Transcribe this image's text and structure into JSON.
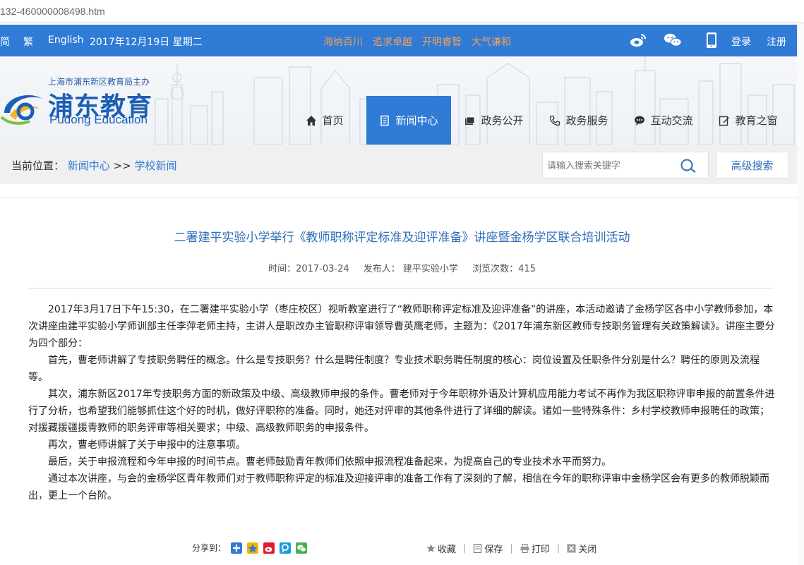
{
  "browser": {
    "url": "132-460000008498.htm"
  },
  "topbar": {
    "lang_simplified": "简",
    "lang_traditional": "繁",
    "lang_english": "English",
    "date": "2017年12月19日 星期二",
    "slogans": [
      "海纳百川",
      "追求卓越",
      "开明睿智",
      "大气谦和"
    ],
    "login": "登录",
    "register": "注册",
    "icons": [
      "weibo-icon",
      "wechat-icon",
      "mobile-icon"
    ]
  },
  "logo": {
    "subtitle": "上海市浦东新区教育局主办",
    "name_cn": "浦东教育",
    "name_en": "Pudong  Education"
  },
  "nav": {
    "items": [
      {
        "label": "首页",
        "icon": "home-icon"
      },
      {
        "label": "新闻中心",
        "icon": "document-icon",
        "active": true
      },
      {
        "label": "政务公开",
        "icon": "folder-icon"
      },
      {
        "label": "政务服务",
        "icon": "phone-icon"
      },
      {
        "label": "互动交流",
        "icon": "chat-icon"
      },
      {
        "label": "教育之窗",
        "icon": "edit-icon"
      }
    ]
  },
  "breadcrumb": {
    "prefix": "当前位置：",
    "level1": "新闻中心",
    "sep": " >> ",
    "level2": "学校新闻"
  },
  "search": {
    "placeholder": "请输入搜索关键字",
    "advanced": "高级搜索"
  },
  "article": {
    "title": "二署建平实验小学举行《教师职称评定标准及迎评准备》讲座暨金杨学区联合培训活动",
    "time": "时间：2017-03-24",
    "publisher": "发布人： 建平实验小学",
    "views": "浏览次数：415",
    "paragraphs": [
      "2017年3月17日下午15:30，在二署建平实验小学（枣庄校区）视听教室进行了“教师职称评定标准及迎评准备”的讲座，本活动邀请了金杨学区各中小学教师参加，本次讲座由建平实验小学师训部主任李萍老师主持，主讲人是职改办主管职称评审领导曹英鹰老师，主题为：《2017年浦东新区教师专技职务管理有关政策解读》。讲座主要分为四个部分：",
      "首先，曹老师讲解了专技职务聘任的概念。什么是专技职务？什么是聘任制度？专业技术职务聘任制度的核心：岗位设置及任职条件分别是什么？聘任的原则及流程等。",
      "其次，浦东新区2017年专技职务方面的新政策及中级、高级教师申报的条件。曹老师对于今年职称外语及计算机应用能力考试不再作为我区职称评审申报的前置条件进行了分析，也希望我们能够抓住这个好的时机，做好评职称的准备。同时，她还对评审的其他条件进行了详细的解读。诸如一些特殊条件：乡村学校教师申报聘任的政策；对援藏援疆援青教师的职务评审等相关要求；中级、高级教师职务的申报条件。",
      "再次，曹老师讲解了关于申报中的注意事项。",
      "最后，关于申报流程和今年申报的时间节点。曹老师鼓励青年教师们依照申报流程准备起来，为提高自己的专业技术水平而努力。",
      "通过本次讲座，与会的金杨学区青年教师们对于教师职称评定的标准及迎接评审的准备工作有了深刻的了解，相信在今年的职称评审中金杨学区会有更多的教师脱颖而出，更上一个台阶。"
    ]
  },
  "footer": {
    "share_label": "分享到：",
    "share_icons": [
      "share-plus-icon",
      "qzone-icon",
      "sina-weibo-icon",
      "tencent-icon",
      "wechat-share-icon"
    ],
    "favorite": "收藏",
    "save": "保存",
    "print": "打印",
    "close": "关闭"
  },
  "colors": {
    "primary": "#2f7bd6",
    "slogan": "#f5a15a",
    "link": "#2f6fba"
  }
}
